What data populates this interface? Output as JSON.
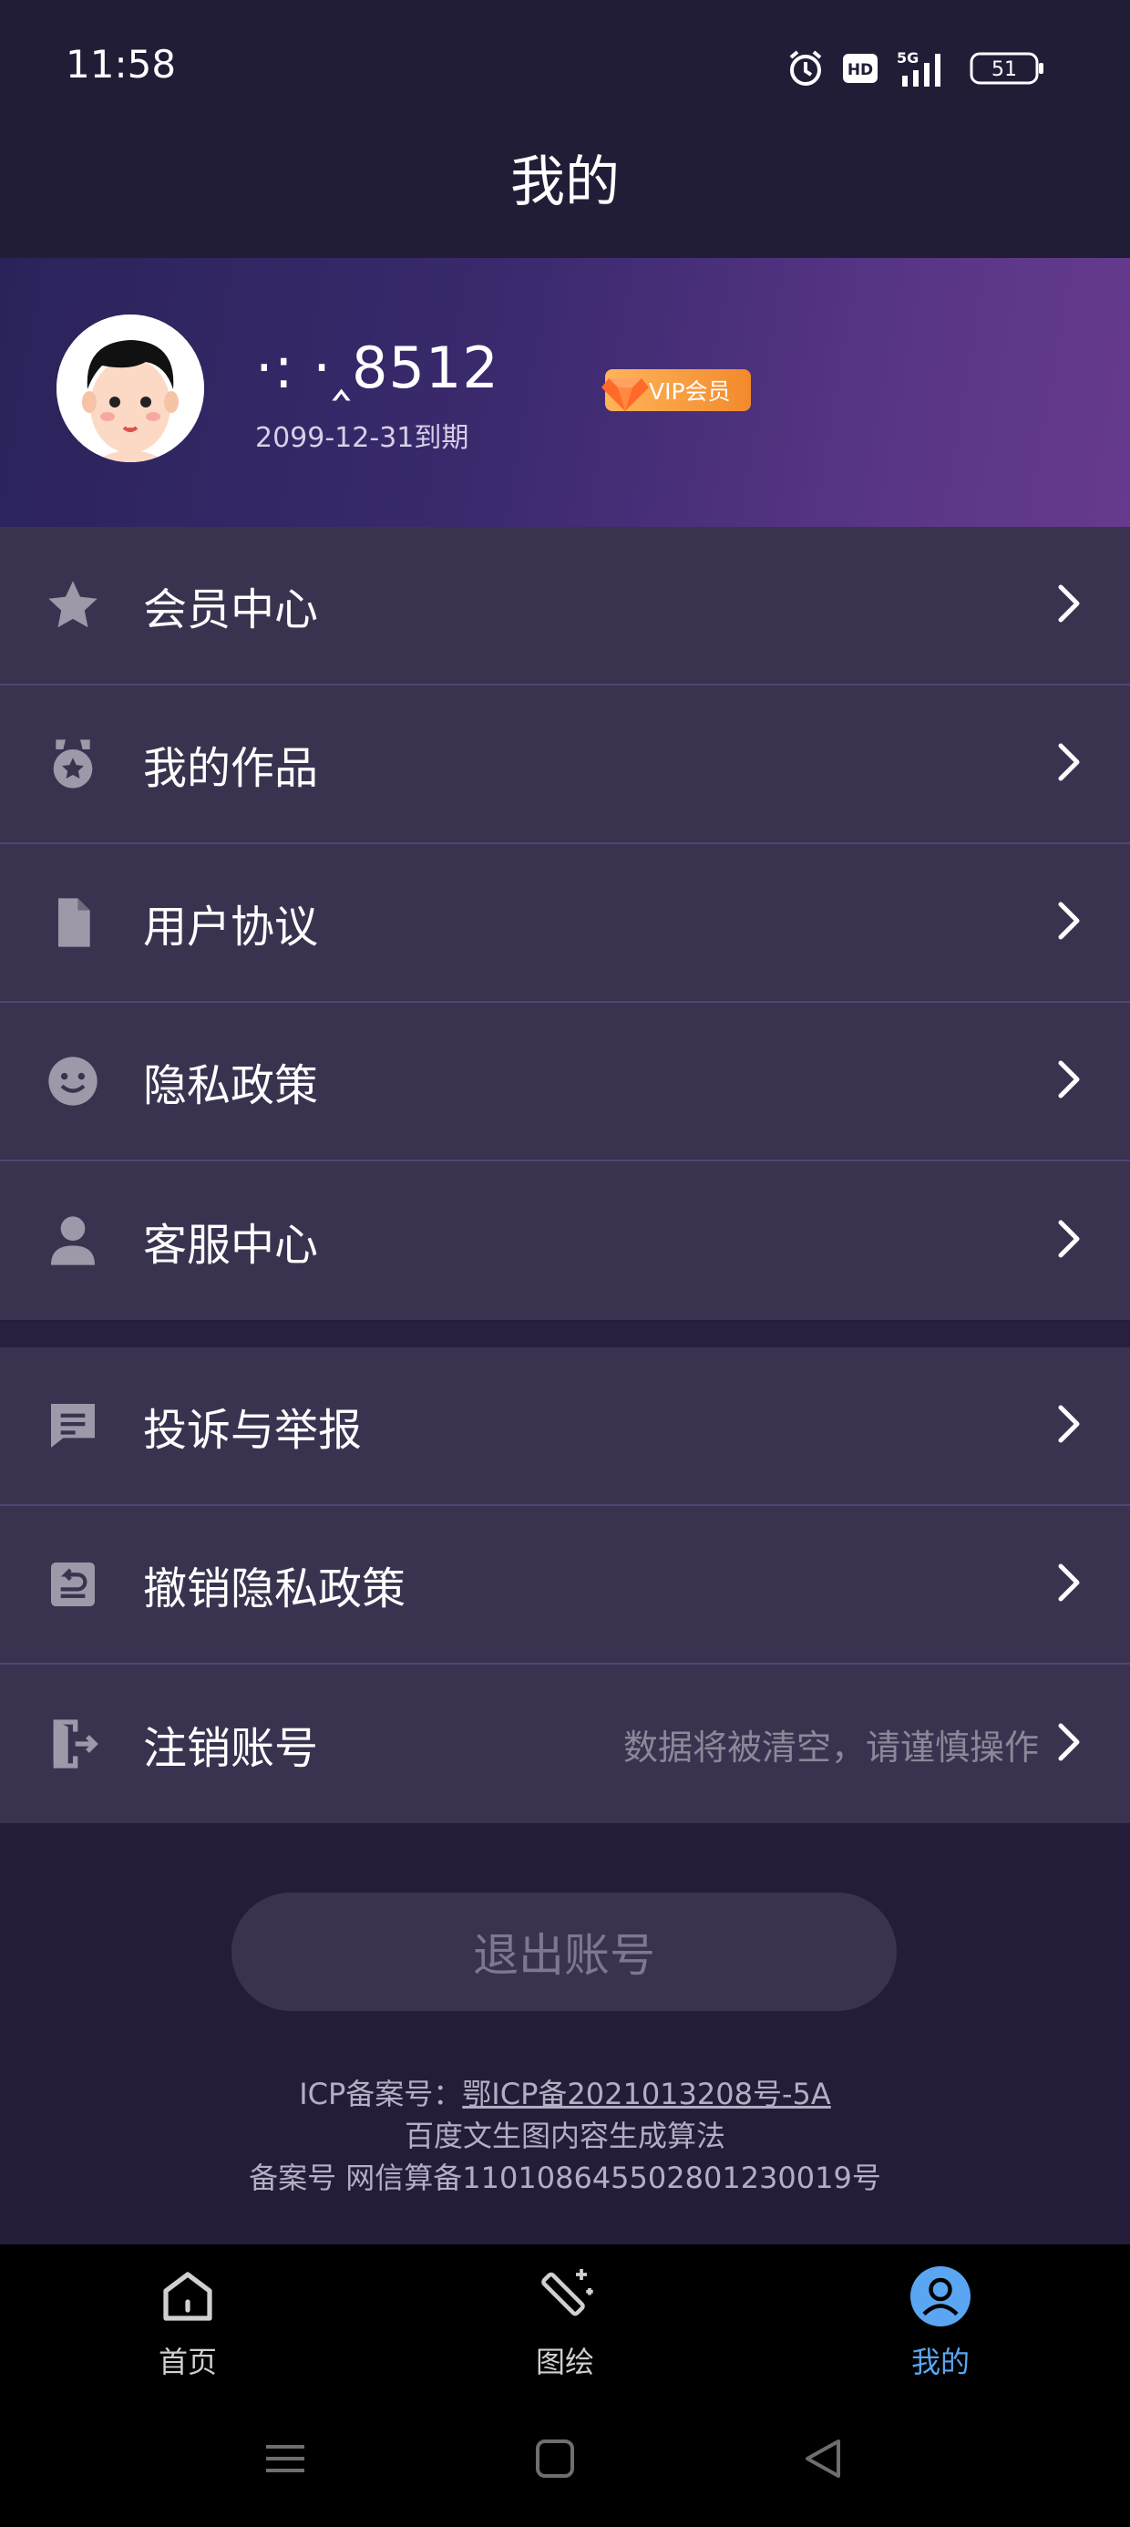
{
  "status_bar": {
    "time": "11:58",
    "network": "5G",
    "hd": "HD",
    "battery": "51",
    "icons": [
      "alarm-icon",
      "hd-icon",
      "signal-icon",
      "battery-icon"
    ]
  },
  "header": {
    "title": "我的"
  },
  "profile": {
    "username": "·:     ·‸8512",
    "vip_label": "VIP会员",
    "expiry": "2099-12-31到期"
  },
  "menu_group_1": [
    {
      "label": "会员中心",
      "icon": "star-icon"
    },
    {
      "label": "我的作品",
      "icon": "medal-icon"
    },
    {
      "label": "用户协议",
      "icon": "document-icon"
    },
    {
      "label": "隐私政策",
      "icon": "smile-icon"
    },
    {
      "label": "客服中心",
      "icon": "person-icon"
    }
  ],
  "menu_group_2": [
    {
      "label": "投诉与举报",
      "icon": "chat-icon",
      "hint": ""
    },
    {
      "label": "撤销隐私政策",
      "icon": "revoke-icon",
      "hint": ""
    },
    {
      "label": "注销账号",
      "icon": "exit-icon",
      "hint": "数据将被清空，请谨慎操作"
    }
  ],
  "logout_label": "退出账号",
  "footer": {
    "icp_prefix": "ICP备案号：",
    "icp_number": "鄂ICP备2021013208号-5A",
    "line2": "百度文生图内容生成算法",
    "line3": "备案号 网信算备110108645502801230019号"
  },
  "tabs": [
    {
      "label": "首页",
      "icon": "home-icon",
      "active": false
    },
    {
      "label": "图绘",
      "icon": "magic-wand-icon",
      "active": false
    },
    {
      "label": "我的",
      "icon": "user-circle-icon",
      "active": true
    }
  ],
  "colors": {
    "background": "#231d3a",
    "menu_bg": "#3a3350",
    "accent": "#5aa6f2",
    "vip_orange": "#f28a2c"
  }
}
